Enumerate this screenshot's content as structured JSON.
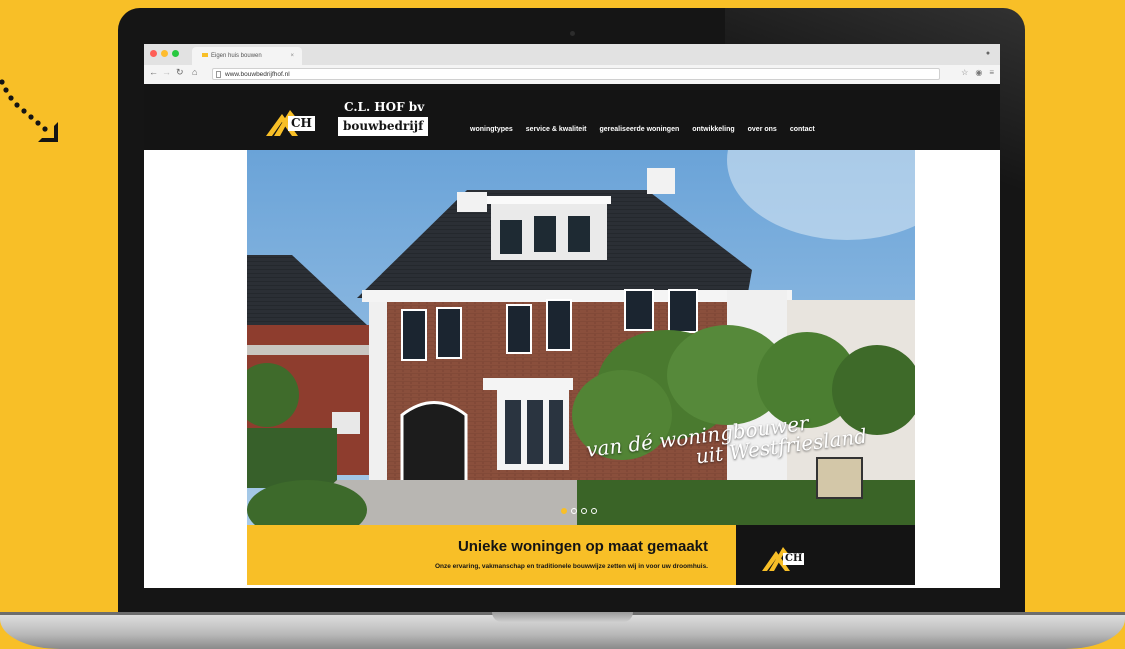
{
  "browser": {
    "tab_title": "Eigen huis bouwen",
    "url": "www.bouwbedrijfhof.nl"
  },
  "site": {
    "logo_name": "C.L. HOF bv",
    "logo_sub": "bouwbedrijf",
    "logo_mark": "CH",
    "nav": [
      "woningtypes",
      "service & kwaliteit",
      "gerealiseerde woningen",
      "ontwikkeling",
      "over ons",
      "contact"
    ],
    "hero_caption_line1": "van dé woningbouwer",
    "hero_caption_line2": "uit Westfriesland",
    "cta_title": "Unieke woningen op maat gemaakt",
    "cta_sub": "Onze ervaring, vakmanschap en traditionele bouwwijze zetten wij in voor uw droomhuis.",
    "slider_dots": 4,
    "slider_active": 1
  },
  "colors": {
    "brand_yellow": "#F8BF27",
    "header_dark": "#141414"
  }
}
